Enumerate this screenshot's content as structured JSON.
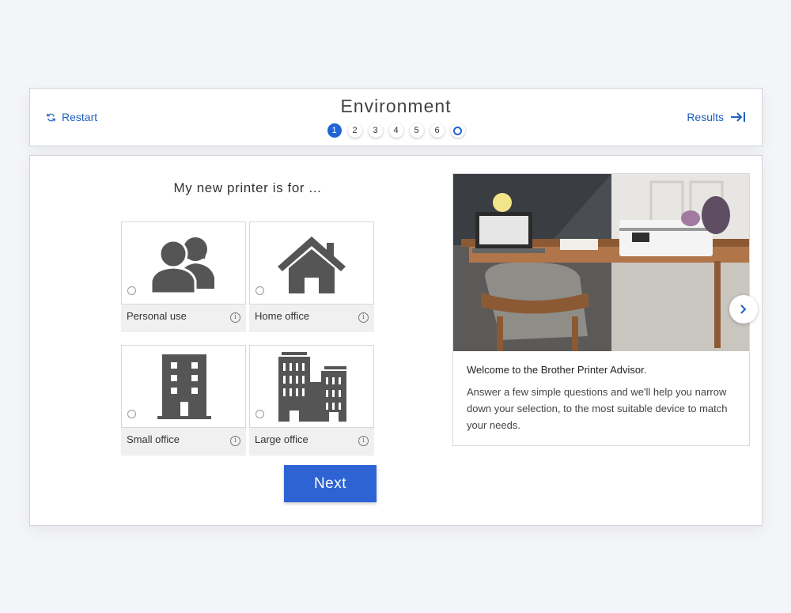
{
  "header": {
    "restart_label": "Restart",
    "title": "Environment",
    "results_label": "Results",
    "steps": [
      "1",
      "2",
      "3",
      "4",
      "5",
      "6"
    ],
    "active_step": "1"
  },
  "main": {
    "question": "My new printer is for ...",
    "options": [
      {
        "label": "Personal use",
        "icon": "people-icon"
      },
      {
        "label": "Home office",
        "icon": "house-icon"
      },
      {
        "label": "Small office",
        "icon": "small-building-icon"
      },
      {
        "label": "Large office",
        "icon": "large-building-icon"
      }
    ],
    "info_glyph": "i",
    "next_label": "Next"
  },
  "info_card": {
    "welcome": "Welcome to the Brother Printer Advisor.",
    "description": "Answer a few simple questions and we'll help you narrow down your selection, to the most suitable device to match your needs."
  },
  "colors": {
    "accent": "#2d63d3",
    "link": "#1f5fbf",
    "icon": "#555555",
    "background": "#f4f5f8"
  }
}
